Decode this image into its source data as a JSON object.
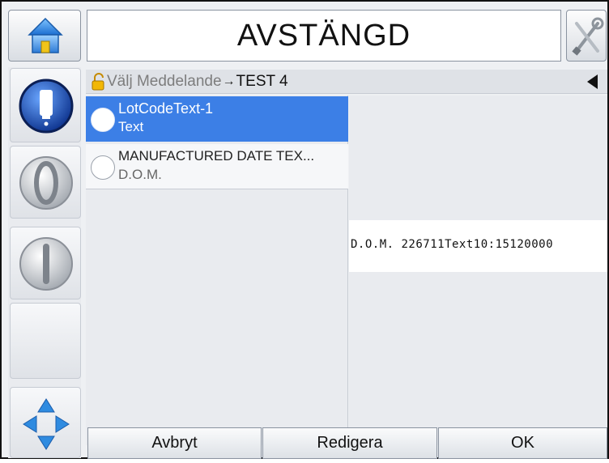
{
  "header": {
    "title": "AVSTÄNGD",
    "home_icon": "home-icon",
    "tools_icon": "tools-icon"
  },
  "rail": {
    "icons": [
      "printhead-icon",
      "nozzle-start-icon",
      "nozzle-stop-icon",
      "navigation-arrows-icon"
    ]
  },
  "breadcrumb": {
    "label": "Välj Meddelande",
    "separator": "→",
    "current": "TEST 4"
  },
  "fields": [
    {
      "name": "LotCodeText-1",
      "type": "Text",
      "selected": true
    },
    {
      "name": "MANUFACTURED DATE TEX...",
      "type": "D.O.M.",
      "selected": false
    }
  ],
  "preview": {
    "text": "D.O.M. 226711Text10:15120000"
  },
  "buttons": {
    "cancel": "Avbryt",
    "edit": "Redigera",
    "ok": "OK"
  },
  "colors": {
    "selected": "#3c7fe6",
    "panel": "#e9ebef"
  }
}
